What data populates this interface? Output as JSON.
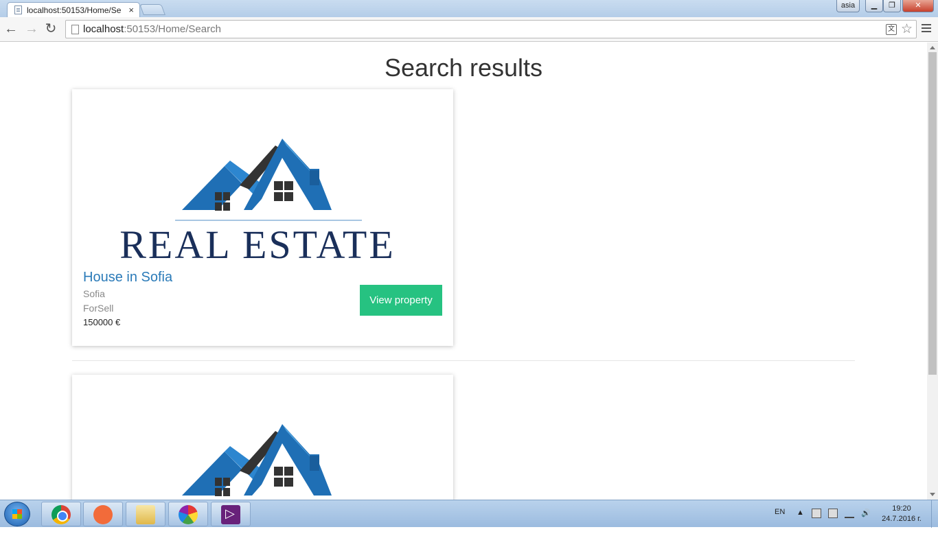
{
  "browser": {
    "tab_title": "localhost:50153/Home/Se",
    "tab_close": "×",
    "url_host": "localhost",
    "url_rest": ":50153/Home/Search",
    "user_badge": "asia",
    "win_min": "▁",
    "win_max": "❐",
    "win_close": "✕",
    "nav_back": "←",
    "nav_forward": "→",
    "nav_reload": "↻",
    "star": "☆",
    "translate": "文"
  },
  "page": {
    "title": "Search results",
    "logo_text": "REAL ESTATE",
    "results": [
      {
        "title": "House in Sofia",
        "city": "Sofia",
        "status": "ForSell",
        "price": "150000 €",
        "button": "View property"
      }
    ]
  },
  "taskbar": {
    "language": "EN",
    "tray_arrow": "▲",
    "time": "19:20",
    "date": "24.7.2016 г.",
    "apps": [
      "chrome",
      "postman",
      "explorer",
      "picasa",
      "visual-studio"
    ]
  },
  "colors": {
    "accent_button": "#26c281",
    "link_blue": "#2a7ab8",
    "logo_navy": "#1a2f5a",
    "roof_blue": "#1f6fb5"
  }
}
